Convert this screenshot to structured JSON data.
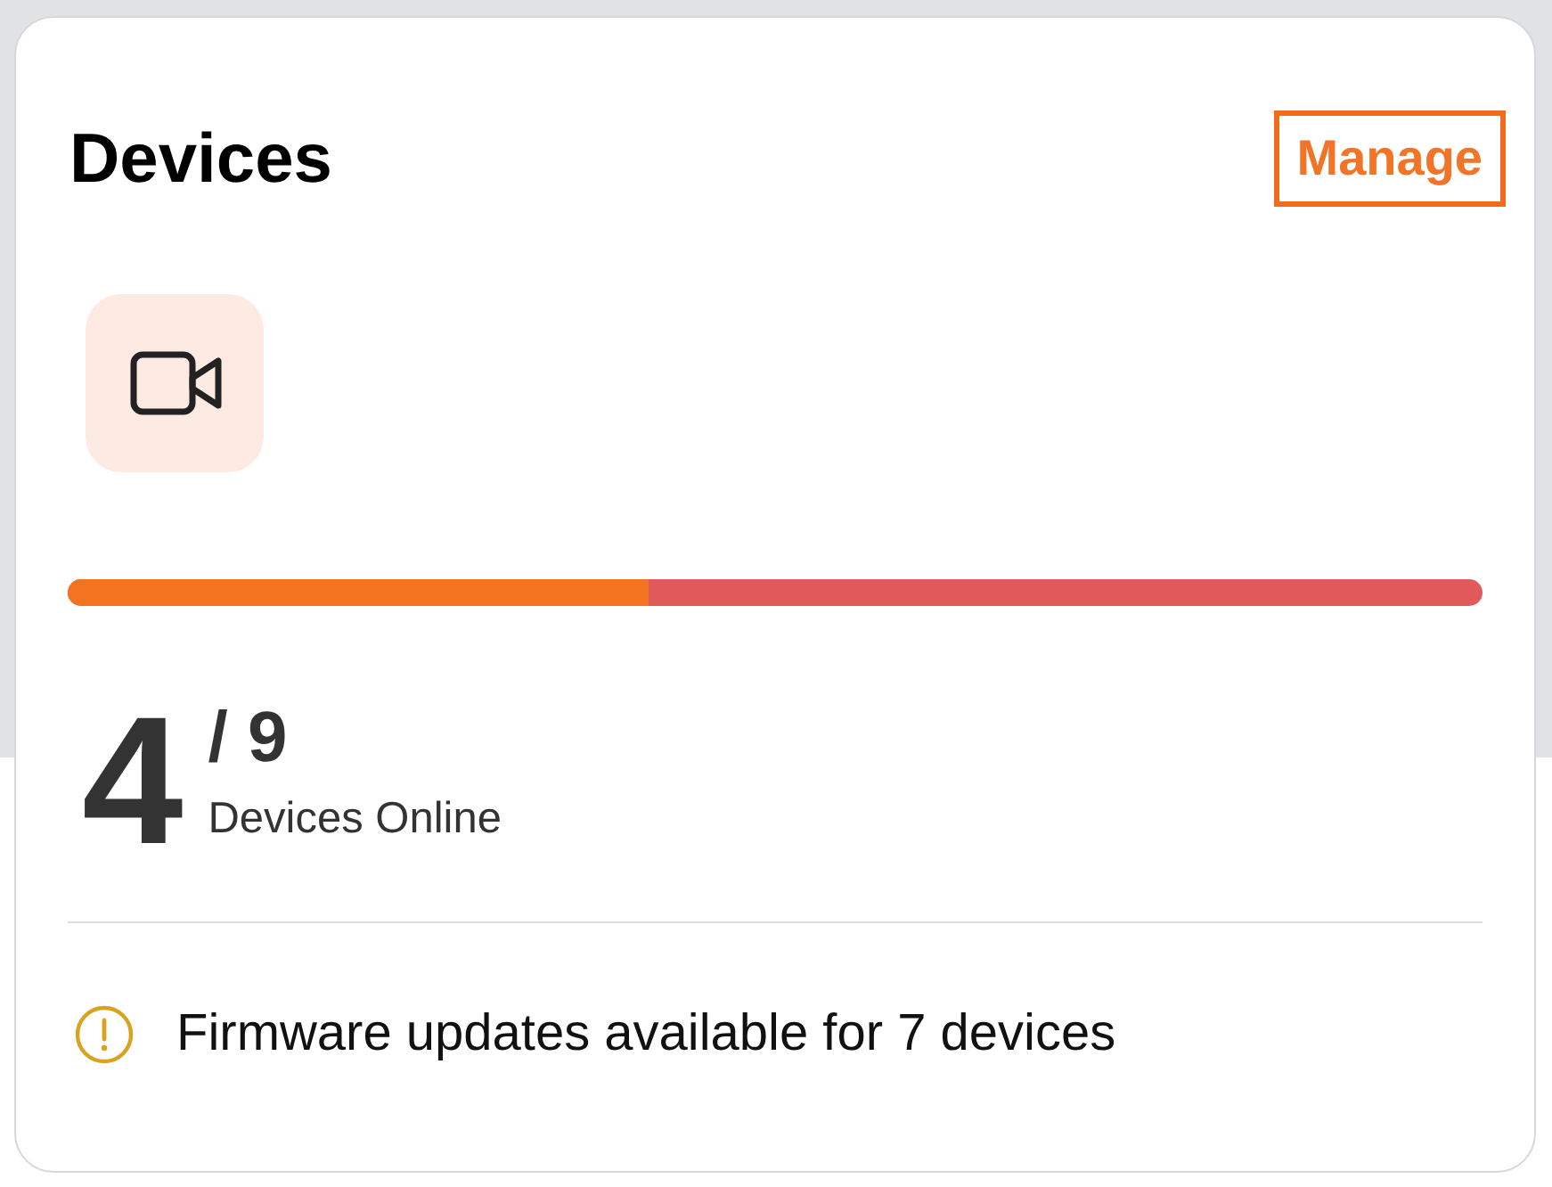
{
  "card": {
    "title": "Devices",
    "action": {
      "label": "Manage",
      "focused": true
    },
    "progress": {
      "level": 0.41
    },
    "stats": {
      "online": "4",
      "total": "/ 9",
      "label": "Devices Online"
    },
    "notice": {
      "text": "Firmware updates available for 7 devices"
    }
  }
}
